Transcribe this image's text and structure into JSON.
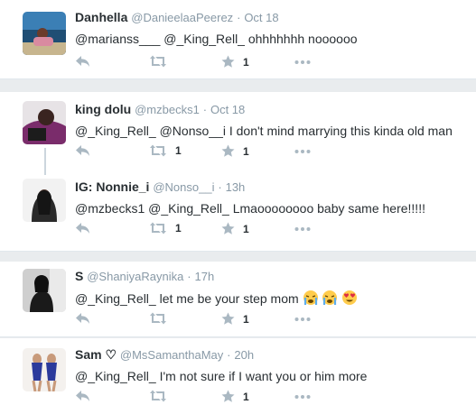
{
  "tweets": [
    {
      "fullname": "Danhella",
      "username": "@DanieelaaPeerez",
      "time": "Oct 18",
      "text": "@marianss___ @_King_Rell_ ohhhhhhh noooooo",
      "retweets": "",
      "likes": "1"
    },
    {
      "fullname": "king dolu",
      "username": "@mzbecks1",
      "time": "Oct 18",
      "text": "@_King_Rell_ @Nonso__i I don't mind marrying this kinda old man",
      "retweets": "1",
      "likes": "1"
    },
    {
      "fullname": "IG: Nonnie_i",
      "username": "@Nonso__i",
      "time": "13h",
      "text": "@mzbecks1 @_King_Rell_ Lmaoooooooo baby same here!!!!!",
      "retweets": "1",
      "likes": "1"
    },
    {
      "fullname": "S",
      "username": "@ShaniyaRaynika",
      "time": "17h",
      "text": "@_King_Rell_  let me be your step mom",
      "retweets": "",
      "likes": "1"
    },
    {
      "fullname": "Sam ♡",
      "username": "@MsSamanthaMay",
      "time": "20h",
      "text": "@_King_Rell_  I'm not sure if I want you or him more",
      "retweets": "",
      "likes": "1"
    }
  ],
  "separator_dot": "·",
  "colors": {
    "background": "#e9ecee",
    "card": "#ffffff",
    "secondary_text": "#8899a6",
    "primary_text": "#292f33",
    "border": "#e1e8ed"
  },
  "icons": [
    "reply-icon",
    "retweet-icon",
    "like-star-icon",
    "more-dots-icon"
  ]
}
